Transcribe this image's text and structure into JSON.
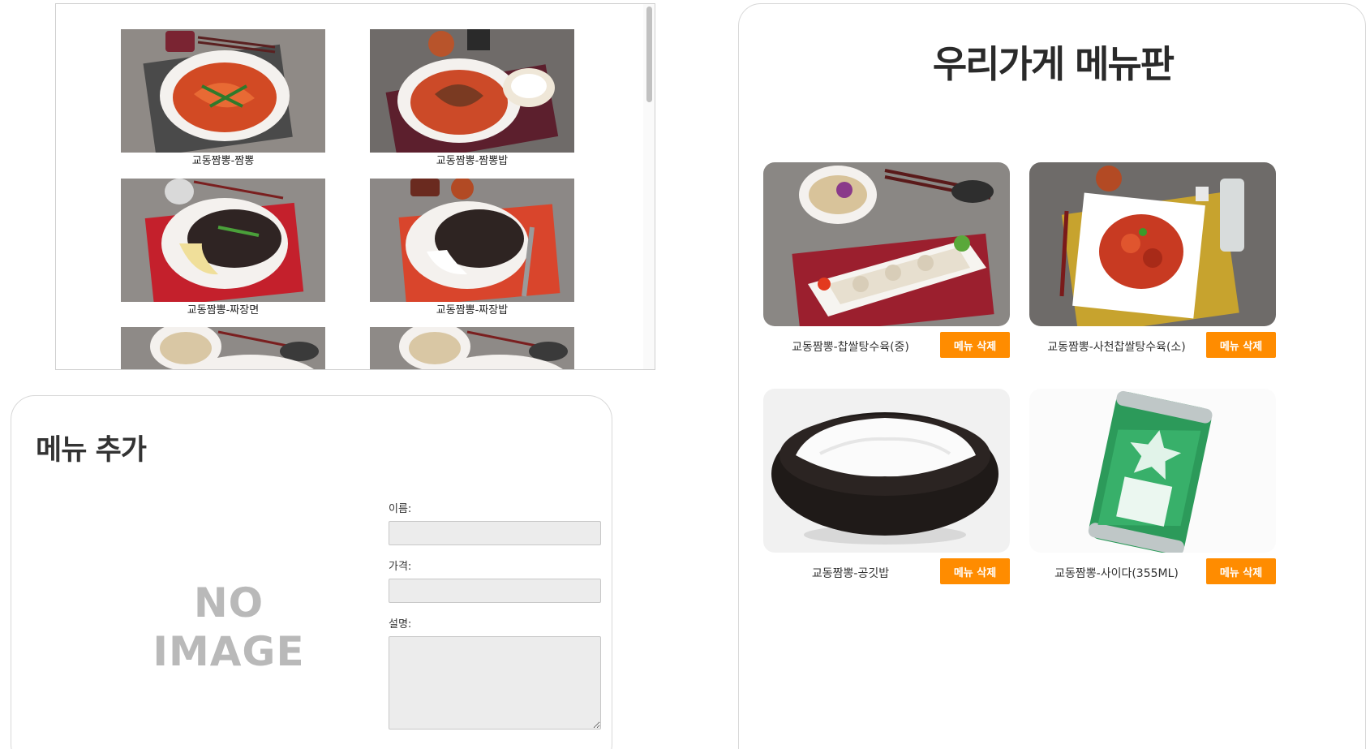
{
  "catalog": {
    "items": [
      {
        "caption": "교동짬뽕-짬뽕",
        "image_icon": "jjamppong-photo"
      },
      {
        "caption": "교동짬뽕-짬뽕밥",
        "image_icon": "jjamppong-bap-photo"
      },
      {
        "caption": "교동짬뽕-짜장면",
        "image_icon": "jjajangmyeon-photo"
      },
      {
        "caption": "교동짬뽕-짜장밥",
        "image_icon": "jjajang-bap-photo"
      },
      {
        "caption": "",
        "image_icon": "tangsuyuk-photo"
      },
      {
        "caption": "",
        "image_icon": "tangsuyuk-photo"
      }
    ]
  },
  "add_menu": {
    "title": "메뉴 추가",
    "no_image_line1": "NO",
    "no_image_line2": "IMAGE",
    "name_label": "이름:",
    "name_value": "",
    "price_label": "가격:",
    "price_value": "",
    "description_label": "설명:",
    "description_value": ""
  },
  "board": {
    "title": "우리가게 메뉴판",
    "delete_label": "메뉴 삭제",
    "items": [
      {
        "name": "교동짬뽕-찹쌀탕수육(중)",
        "image_icon": "tangsuyuk-photo"
      },
      {
        "name": "교동짬뽕-사천찹쌀탕수육(소)",
        "image_icon": "sacheon-tangsuyuk-photo"
      },
      {
        "name": "교동짬뽕-공깃밥",
        "image_icon": "rice-bowl-photo"
      },
      {
        "name": "교동짬뽕-사이다(355ML)",
        "image_icon": "cider-can-photo"
      }
    ]
  },
  "colors": {
    "accent": "#ff8c00",
    "input_bg": "#ececec",
    "no_image_text": "#b9b9b9"
  }
}
